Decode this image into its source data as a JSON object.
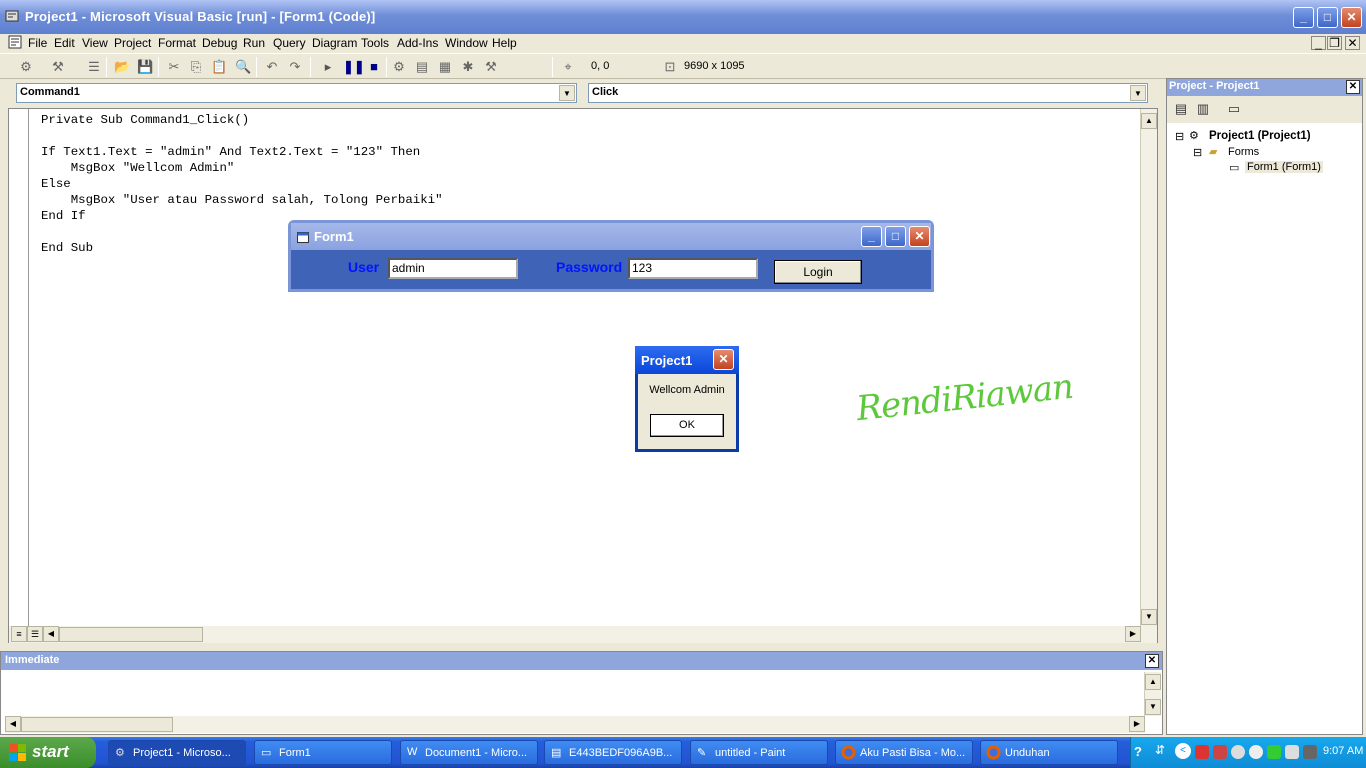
{
  "window": {
    "title": "Project1 - Microsoft Visual Basic [run] - [Form1 (Code)]",
    "min": "_",
    "max": "□",
    "close": "✕"
  },
  "menu": [
    "File",
    "Edit",
    "View",
    "Project",
    "Format",
    "Debug",
    "Run",
    "Query",
    "Diagram",
    "Tools",
    "Add-Ins",
    "Window",
    "Help"
  ],
  "toolbar": {
    "position": "0, 0",
    "size": "9690 x 1095"
  },
  "combos": {
    "object": "Command1",
    "procedure": "Click"
  },
  "code": [
    "Private Sub Command1_Click()",
    "",
    "If Text1.Text = \"admin\" And Text2.Text = \"123\" Then",
    "    MsgBox \"Wellcom Admin\"",
    "Else",
    "    MsgBox \"User atau Password salah, Tolong Perbaiki\"",
    "End If",
    "",
    "End Sub"
  ],
  "form1": {
    "title": "Form1",
    "user_label": "User",
    "user_value": "admin",
    "password_label": "Password",
    "password_value": "123",
    "login_button": "Login"
  },
  "msgbox": {
    "title": "Project1",
    "message": "Wellcom Admin",
    "ok": "OK"
  },
  "signature": "RendiRiawan",
  "project_panel": {
    "title": "Project - Project1",
    "root": "Project1 (Project1)",
    "folder": "Forms",
    "item": "Form1 (Form1)"
  },
  "immediate": {
    "title": "Immediate"
  },
  "taskbar": {
    "start": "start",
    "tasks": [
      "Project1 - Microso...",
      "Form1",
      "Document1 - Micro...",
      "E443BEDF096A9B...",
      "untitled - Paint",
      "Aku Pasti Bisa - Mo...",
      "Unduhan"
    ],
    "clock": "9:07 AM"
  },
  "colors": {
    "form_bg": "#3f63b7",
    "label_blue": "#0015ff",
    "signature_green": "#5dc83c",
    "taskbar_blue": "#245edb"
  }
}
